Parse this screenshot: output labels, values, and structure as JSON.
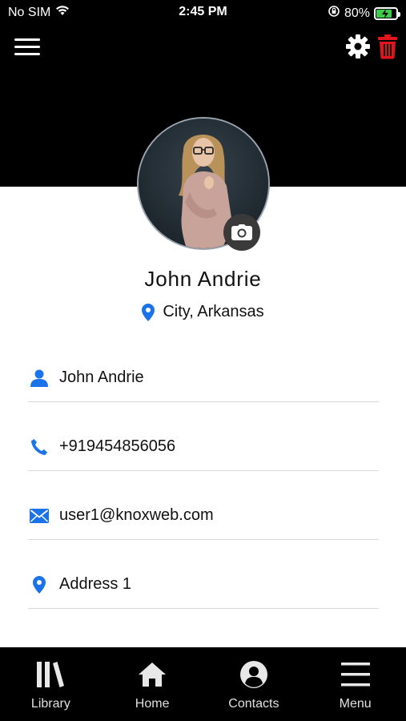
{
  "status_bar": {
    "carrier": "No SIM",
    "time": "2:45 PM",
    "battery_percent": "80%",
    "battery_level": 0.8,
    "wifi_icon": "wifi-icon",
    "orientation_lock_icon": "orientation-lock-icon"
  },
  "header": {
    "menu_icon": "hamburger-menu-icon",
    "settings_icon": "gear-icon",
    "delete_icon": "trash-icon",
    "delete_color": "#e1151b"
  },
  "profile": {
    "name": "John Andrie",
    "location": "City, Arkansas",
    "avatar": "profile-photo",
    "camera_icon": "camera-icon"
  },
  "fields": [
    {
      "icon": "person-icon",
      "value": "John Andrie"
    },
    {
      "icon": "phone-icon",
      "value": "+919454856056"
    },
    {
      "icon": "email-icon",
      "value": "user1@knoxweb.com"
    },
    {
      "icon": "location-pin-icon",
      "value": "Address 1"
    }
  ],
  "bottom_nav": [
    {
      "icon": "library-icon",
      "label": "Library"
    },
    {
      "icon": "home-icon",
      "label": "Home"
    },
    {
      "icon": "contacts-icon",
      "label": "Contacts"
    },
    {
      "icon": "menu-icon",
      "label": "Menu"
    }
  ],
  "colors": {
    "accent": "#1a73e8",
    "header_bg": "#000000",
    "battery_fill": "#3ccc4a"
  }
}
